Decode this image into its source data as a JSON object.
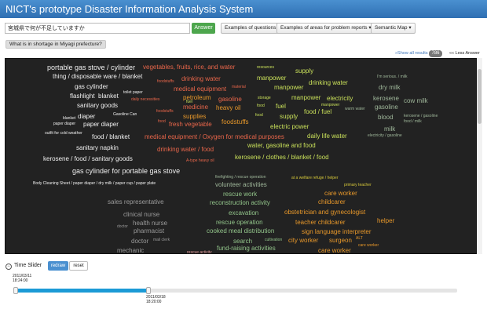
{
  "app": {
    "title": "NICT's prototype Disaster Information Analysis System"
  },
  "search": {
    "query": "宮城県で何が不足していますか",
    "answer_label": "Answer"
  },
  "toolbar": {
    "examples_questions": "Examples of questions",
    "examples_areas": "Examples of areas for problem reports",
    "semantic_map": "Semantic Map"
  },
  "question_tag": "What is in shortage in Miyagi prefecture?",
  "results": {
    "show_all": "»Show all results",
    "count": "786",
    "less_answer": "«« Less Answer"
  },
  "cloud": {
    "colors": {
      "background": "#222222",
      "white": "#f0f0f0",
      "red": "#e8664a",
      "orange": "#e8982a",
      "yellow": "#d7c93a",
      "lime": "#c9e05a",
      "green": "#92c48a",
      "sage": "#9fb79a",
      "pink": "#e09a9a",
      "gray": "#9a9a9a"
    },
    "words": [
      "portable gas stove / cylinder",
      "vegetables, fruits, rice, and water",
      "resources",
      "supply",
      "thing / disposable ware / blanket",
      "foodstuffs",
      "drinking water",
      "manpower",
      "drinking water",
      "I'm serious. / milk",
      "gas cylinder",
      "medical equipment",
      "material",
      "manpower",
      "dry milk",
      "flashlight",
      "blanket",
      "toilet paper",
      "petroleum",
      "gasoline",
      "storage",
      "manpower",
      "electricity",
      "daily necessities",
      "fuel",
      "kerosene",
      "cow milk",
      "sanitary goods",
      "medicine",
      "heavy oil",
      "food",
      "fuel",
      "manpower",
      "gasoline",
      "diaper",
      "Gasoline Can",
      "foodstuffs",
      "supplies",
      "food",
      "supply",
      "food / fuel",
      "warm water",
      "blood",
      "kerosene / gasoline",
      "blanket",
      "paper diaper",
      "paper diaper",
      "food",
      "fresh vegetable",
      "foodstuffs",
      "food / milk",
      "electric power",
      "milk",
      "outfit for cold weather",
      "food / blanket",
      "medical equipment / Oxygen for medical purposes",
      "daily life water",
      "electricity / gasoline",
      "sanitary napkin",
      "drinking water / food",
      "water, gasoline and food",
      "kerosene / food / sanitary goods",
      "kerosene / clothes / blanket / food",
      "A-type heavy oil",
      "gas cylinder for portable gas stove",
      "firefighting / rescue operation",
      "at a welfare refuge / helper",
      "Body Cleaning Sheet / paper diaper / dry milk / paper cup / paper plate",
      "volunteer activities",
      "primary teacher",
      "rescue work",
      "care worker",
      "sales representative",
      "reconstruction activity",
      "childcarer",
      "excavation",
      "obstetrician and gynecologist",
      "clinical nurse",
      "rescue operation",
      "teacher childcarer",
      "helper",
      "health nurse",
      "cooked meal distribution",
      "sign language interpreter",
      "doctor",
      "pharmacist",
      "search",
      "cultivation",
      "city worker",
      "surgeon",
      "ALT",
      "doctor",
      "mail clerk",
      "care worker",
      "mechanic",
      "rescue activity",
      "fund-raising activities",
      "care worker"
    ]
  },
  "time_slider": {
    "label": "Time Slider",
    "redraw_label": "redraw",
    "reset_label": "reset",
    "start_date": "2011/03/11",
    "start_time": "18:24:00",
    "end_date": "2011/03/18",
    "end_time": "18:20:00",
    "selected_fraction": 0.3
  }
}
